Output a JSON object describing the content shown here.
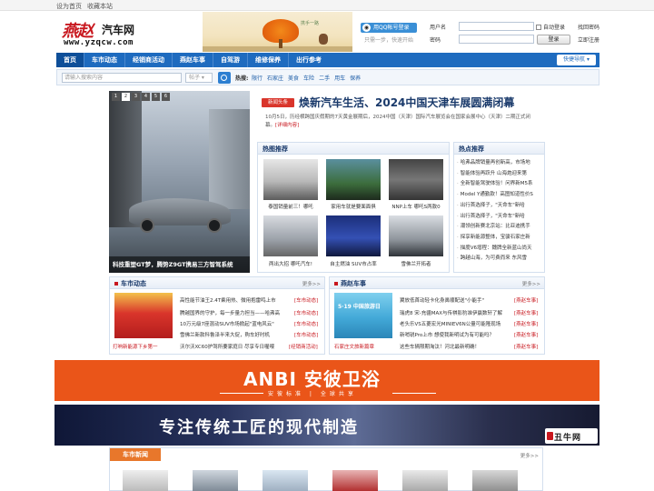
{
  "topbar": {
    "links": [
      "设为首页",
      "收藏本站"
    ]
  },
  "logo": {
    "big": "燕赵",
    "cn": "汽车网",
    "url": "www.yzqcw.com"
  },
  "banner_slogan": "携手一路",
  "login": {
    "qq_label": "用QQ帐号登录",
    "qq_sub": "只需一步，快速开始",
    "user_label": "用户名",
    "pass_label": "密码",
    "remember": "自动登录",
    "forgot": "找回密码",
    "submit": "登录",
    "register": "立即注册"
  },
  "nav": {
    "items": [
      "首页",
      "车市动态",
      "经销商活动",
      "燕赵车事",
      "自驾游",
      "维修保养",
      "出行参考"
    ],
    "quick": "快捷导航 ▾"
  },
  "search": {
    "placeholder": "请输入搜索内容",
    "select": "帖子 ▾",
    "hot_label": "热搜:",
    "hot": [
      "限行",
      "石家庄",
      "美食",
      "车险",
      "二手",
      "用车",
      "保养"
    ]
  },
  "slide": {
    "pages": [
      "1",
      "2",
      "3",
      "4",
      "5",
      "6"
    ],
    "active": "1",
    "caption": "科技重塑GT梦，腾势Z9GT携易三方智驾系统"
  },
  "headline": {
    "badge": "新闻头条",
    "title": "焕新汽车生活、2024中国天津车展圆满闭幕",
    "summary": "10月5日，历经横跨国庆假期的7天黄金展期后，2024中国（天津）国际汽车展览会在国家会展中心（天津）二期正式闭幕。",
    "more": "[详细内容]"
  },
  "hot_recommend": {
    "title": "热图推荐",
    "items": [
      "泰国销量前三！哪吒",
      "家用车就是要面面俱",
      "NNP上车 哪吒S两款0",
      "两出大招 哪吒汽车!",
      "自主燃油 SUV市占率",
      "雪佛兰开拓者"
    ]
  },
  "hot_points": {
    "title": "热点推荐",
    "items": [
      "哈弗品牌销量再创新高，市场地",
      "智能体验再跃升 山海炮迎来第",
      "全新智能驾驶体验！问界新M5系",
      "Model Y通勤款！高图知道性价S",
      "出行首选择子，\"天命车\"新哈",
      "出行首选择子，\"天命车\"新哈",
      "潮领创新赛北京站：比亚迪携手",
      "探享新能源整体，宝骏石家庄新",
      "描度V6增程：魏牌全新蓝山尚天",
      "跨越山海，为可费而来 东风雪"
    ]
  },
  "market": {
    "title": "车市动态",
    "more": "更多>>",
    "img_caption": "打响新能源下乡第一",
    "items": [
      {
        "text": "高性能节油王2.4T乘用热、微用抱雷鸣上市",
        "tag": "[车市动态]"
      },
      {
        "text": "腾越国界的守护，每一步量力担当——哈弗高",
        "tag": "[车市动态]"
      },
      {
        "text": "10万元级7座混动SUV市场掀起\"蓝电风云\"",
        "tag": "[车市动态]"
      },
      {
        "text": "雪佛兰新款科鲁泽半来大促，购车好时机",
        "tag": "[车市动态]"
      },
      {
        "text": "沃尔沃XC60护驾所要家庭日 尽享专日喔喂",
        "tag": "[经销商活动]"
      }
    ]
  },
  "yanzhao": {
    "title": "燕赵车事",
    "more": "更多>>",
    "img_caption": "石家庄文旅新篇章",
    "img_text": "5·19 中国旅游日",
    "items": [
      {
        "text": "翼放低首动轻卡化身鼻顺配送\"小能手\"",
        "tag": "[燕赵车事]"
      },
      {
        "text": "瑞虎8 宋-充疆MAX与传祺影豹准伊赢数轩了解",
        "tag": "[燕赵车事]"
      },
      {
        "text": "老头乐VS五菱宏光MINIEV6N公量可能隆现场",
        "tag": "[燕赵车事]"
      },
      {
        "text": "新哨锐Pro上市 想使我新明试为有可能吗？",
        "tag": "[燕赵车事]"
      },
      {
        "text": "这些车辆限期淘汰！河北最新明确！",
        "tag": "[燕赵车事]"
      }
    ]
  },
  "ad_anbi": {
    "brand": "ANBI 安彼卫浴",
    "slogan": "安彼标准 | 全球共享"
  },
  "ad_chou": {
    "text": "专注传统工匠的现代制造",
    "logo": "丑牛网"
  },
  "bottom": {
    "tab": "车市新闻",
    "more": "更多>>"
  },
  "colors": {
    "nav_blue": "#1e6bbf",
    "accent_red": "#c8171e",
    "ad_orange": "#ea5519",
    "tab_orange": "#e8772b"
  }
}
